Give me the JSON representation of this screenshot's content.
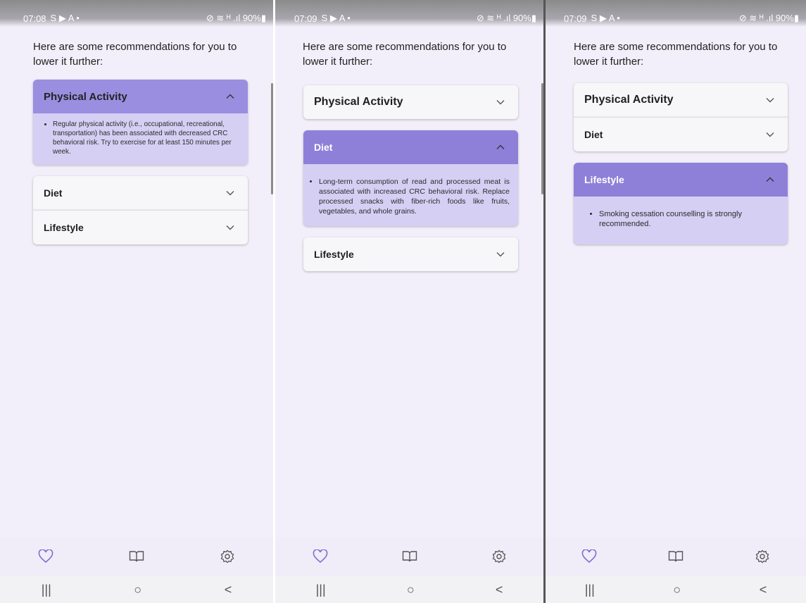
{
  "screens": [
    {
      "status": {
        "time": "07:08",
        "left_icons": "S ▶ A •",
        "right_icons": "⊘ ≋ ᴴ .ıl 90%▮"
      },
      "intro": "Here are some recommendations for you to lower it further:",
      "sections": [
        {
          "title": "Physical Activity",
          "open": true,
          "text": "Regular physical activity (i.e., occupational, recreational, transportation) has been associated with decreased CRC behavioral risk. Try to exercise for at least 150 minutes per week."
        },
        {
          "title": "Diet",
          "open": false
        },
        {
          "title": "Lifestyle",
          "open": false
        }
      ]
    },
    {
      "status": {
        "time": "07:09",
        "left_icons": "S ▶ A •",
        "right_icons": "⊘ ≋ ᴴ .ıl 90%▮"
      },
      "intro": "Here are some recommendations for you to lower it further:",
      "sections": [
        {
          "title": "Physical Activity",
          "open": false
        },
        {
          "title": "Diet",
          "open": true,
          "text": "Long-term consumption of read and processed meat is associated with increased CRC behavioral risk. Replace processed snacks with fiber-rich foods like fruits, vegetables, and whole grains."
        },
        {
          "title": "Lifestyle",
          "open": false
        }
      ]
    },
    {
      "status": {
        "time": "07:09",
        "left_icons": "S ▶ A •",
        "right_icons": "⊘ ≋ ᴴ .ıl 90%▮"
      },
      "intro": "Here are some recommendations for you to lower it further:",
      "sections": [
        {
          "title": "Physical Activity",
          "open": false
        },
        {
          "title": "Diet",
          "open": false
        },
        {
          "title": "Lifestyle",
          "open": true,
          "text": "Smoking cessation counselling is strongly recommended."
        }
      ]
    }
  ],
  "bottom_nav": [
    "heart-icon",
    "book-icon",
    "settings-icon"
  ],
  "system_nav": {
    "recents": "|||",
    "home": "○",
    "back": "<"
  },
  "colors": {
    "accent": "#8e80d9",
    "panel": "#d6cff4",
    "background": "#f3effa",
    "nav_icon": "#7b6fd0"
  }
}
